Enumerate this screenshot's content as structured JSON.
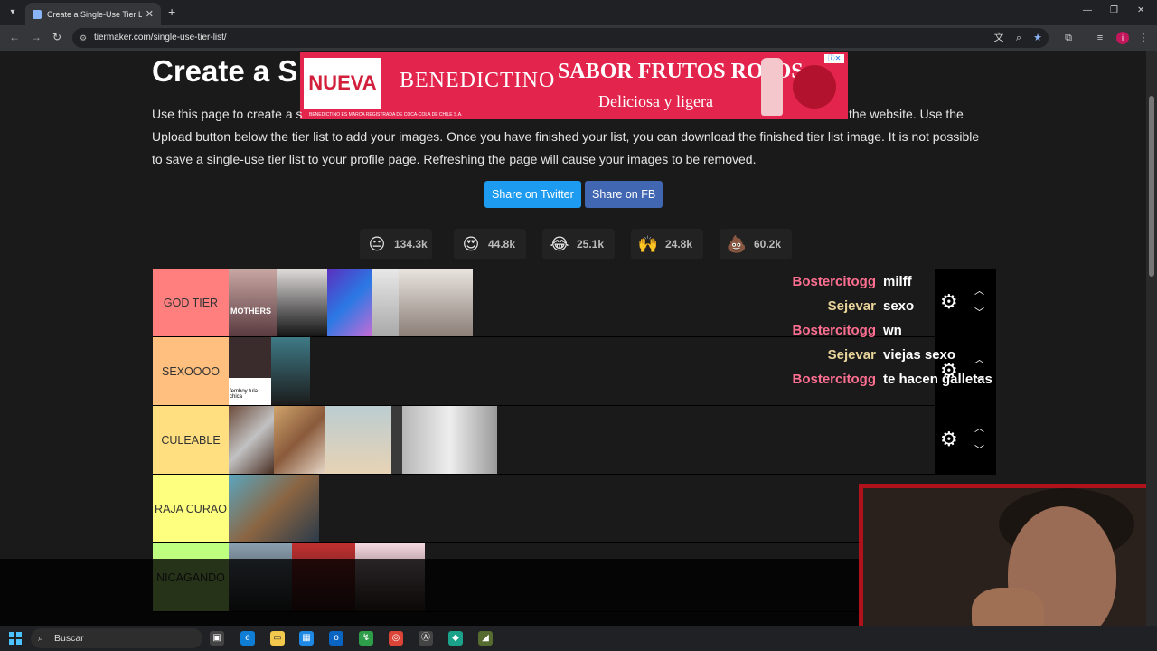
{
  "browser": {
    "tab_title": "Create a Single-Use Tier List (Pi",
    "tab_close": "✕",
    "new_tab": "+",
    "url": "tiermaker.com/single-use-tier-list/"
  },
  "page": {
    "title": "Create a S",
    "description_visible_1": "Use this page to create a s",
    "description_visible_tail_1": "the website. Use the",
    "description_line_2": "Upload button below the tier list to add your images. Once you have finished your list, you can download the finished tier list image. It is not possible",
    "description_line_3": "to save a single-use tier list to your profile page. Refreshing the page will cause your images to be removed.",
    "share_twitter": "Share on Twitter",
    "share_fb": "Share on FB",
    "reactions": [
      {
        "emoji": "😐",
        "count": "134.3k"
      },
      {
        "emoji": "😍",
        "count": "44.8k"
      },
      {
        "emoji": "😂",
        "count": "25.1k"
      },
      {
        "emoji": "🙌",
        "count": "24.8k"
      },
      {
        "emoji": "💩",
        "count": "60.2k"
      }
    ]
  },
  "ad": {
    "tag": "NUEVA",
    "brand": "BENEDICTINO",
    "slogan_1": "SABOR FRUTOS ROJOS",
    "slogan_2": "Deliciosa y ligera",
    "legal": "BENEDICTINO ES MARCA REGISTRADA DE COCA-COLA DE CHILE S.A."
  },
  "tiers": [
    {
      "label": "GOD TIER",
      "color": "#ff7f7f",
      "images": [
        "MOTHERS",
        "",
        "",
        "",
        ""
      ]
    },
    {
      "label": "SEXOOOO",
      "color": "#ffbf7f",
      "images": [
        "femboy tula chica",
        ""
      ]
    },
    {
      "label": "CULEABLE",
      "color": "#ffdf7f",
      "images": [
        "",
        "",
        "",
        "",
        ""
      ]
    },
    {
      "label": "RAJA CURAO",
      "color": "#ffff7f",
      "images": [
        ""
      ]
    },
    {
      "label": "NICAGANDO",
      "color": "#bfff7f",
      "images": [
        "",
        "",
        ""
      ]
    }
  ],
  "chat": [
    {
      "user": "Bostercitogg",
      "color": "#ff6f91",
      "text": "milff"
    },
    {
      "user": "Sejevar",
      "color": "#e8d49a",
      "text": "sexo"
    },
    {
      "user": "Bostercitogg",
      "color": "#ff6f91",
      "text": "wn"
    },
    {
      "user": "Sejevar",
      "color": "#e8d49a",
      "text": "viejas sexo"
    },
    {
      "user": "Bostercitogg",
      "color": "#ff6f91",
      "text": "te hacen galletas"
    }
  ],
  "taskbar": {
    "search_placeholder": "Buscar"
  }
}
